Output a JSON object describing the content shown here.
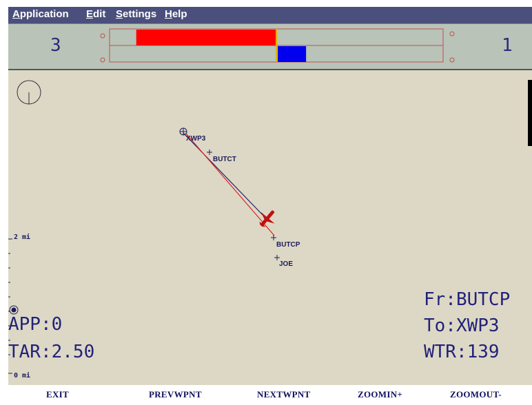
{
  "menu": {
    "items": [
      {
        "label": "Application",
        "accel": "A",
        "rest": "pplication"
      },
      {
        "label": "Edit",
        "accel": "E",
        "rest": "dit"
      },
      {
        "label": "Settings",
        "accel": "S",
        "rest": "ettings"
      },
      {
        "label": "Help",
        "accel": "H",
        "rest": "elp"
      }
    ]
  },
  "panel": {
    "left_value": "3",
    "right_value": "1",
    "top_bar_fill": 0.42,
    "bottom_bar_fill": 0.17,
    "colors": {
      "top_bar": "#ff0000",
      "bottom_bar": "#0000ee",
      "center_marker": "#e0b000",
      "frame": "#c0504d"
    }
  },
  "map": {
    "waypoints": [
      {
        "name": "XWP3"
      },
      {
        "name": "BUTCT"
      },
      {
        "name": "BUTCP"
      },
      {
        "name": "JOE"
      }
    ],
    "scale": {
      "upper": "2 mi",
      "lower": "0 mi"
    },
    "status_left": {
      "app": "APP:0",
      "tar": "TAR:2.50"
    },
    "status_right": {
      "from": "Fr:BUTCP",
      "to": "To:XWP3",
      "wtr": "WTR:139"
    },
    "colors": {
      "track": "#1f1f6f",
      "course": "#dd2020",
      "aircraft": "#c01010",
      "background": "#ddd8c5"
    }
  },
  "softkeys": [
    "EXIT",
    "PREVWPNT",
    "NEXTWPNT",
    "ZOOMIN+",
    "ZOOMOUT-"
  ]
}
